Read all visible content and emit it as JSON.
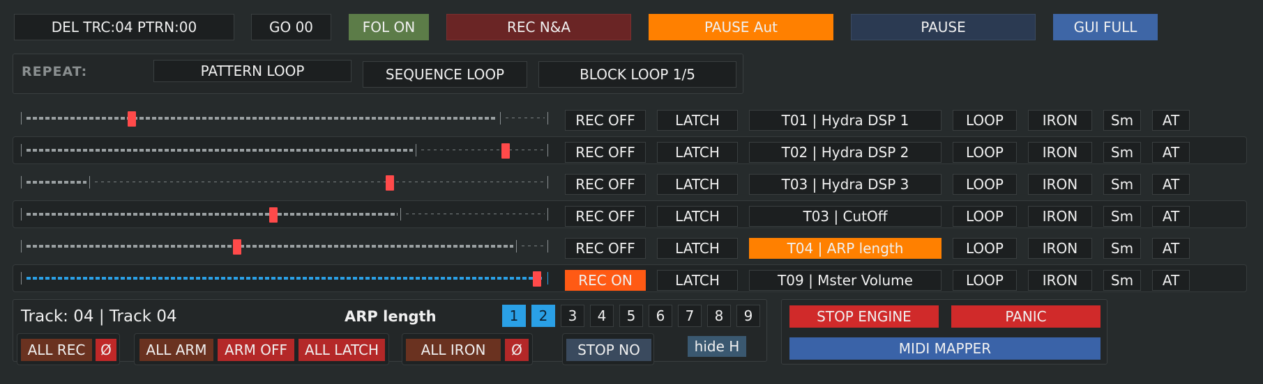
{
  "top": {
    "del_label": "DEL TRC:04 PTRN:00",
    "go_label": "GO 00",
    "fol_label": "FOL ON",
    "rec_na_label": "REC N&A",
    "pause_aut_label": "PAUSE Aut",
    "pause_label": "PAUSE",
    "gui_full_label": "GUI FULL"
  },
  "repeat": {
    "label": "REPEAT:",
    "pattern_loop": "PATTERN LOOP",
    "sequence_loop": "SEQUENCE LOOP",
    "block_loop": "BLOCK LOOP 1/5"
  },
  "tracks": [
    {
      "rec": "REC OFF",
      "latch": "LATCH",
      "name": "T01 | Hydra DSP 1",
      "loop": "LOOP",
      "iron": "IRON",
      "sm": "Sm",
      "at": "AT",
      "value": 0.21,
      "range_end": 0.91
    },
    {
      "rec": "REC OFF",
      "latch": "LATCH",
      "name": "T02 | Hydra  DSP 2",
      "loop": "LOOP",
      "iron": "IRON",
      "sm": "Sm",
      "at": "AT",
      "value": 0.92,
      "range_end": 0.75
    },
    {
      "rec": "REC OFF",
      "latch": "LATCH",
      "name": "T03 | Hydra DSP 3",
      "loop": "LOOP",
      "iron": "IRON",
      "sm": "Sm",
      "at": "AT",
      "value": 0.7,
      "range_end": 0.13
    },
    {
      "rec": "REC OFF",
      "latch": "LATCH",
      "name": "T03 | CutOff",
      "loop": "LOOP",
      "iron": "IRON",
      "sm": "Sm",
      "at": "AT",
      "value": 0.48,
      "range_end": 0.72
    },
    {
      "rec": "REC OFF",
      "latch": "LATCH",
      "name": "T04 | ARP length",
      "loop": "LOOP",
      "iron": "IRON",
      "sm": "Sm",
      "at": "AT",
      "value": 0.41,
      "range_end": 0.94
    },
    {
      "rec": "REC ON",
      "latch": "LATCH",
      "name": "T09 | Mster Volume",
      "loop": "LOOP",
      "iron": "IRON",
      "sm": "Sm",
      "at": "AT",
      "value": 0.98,
      "range_end": 1.0
    }
  ],
  "bottom": {
    "track_info": "Track: 04 | Track 04",
    "param_name": "ARP length",
    "numbers": [
      "1",
      "2",
      "3",
      "4",
      "5",
      "6",
      "7",
      "8",
      "9"
    ],
    "all_rec": "ALL REC",
    "null1": "Ø",
    "all_arm": "ALL ARM",
    "arm_off": "ARM OFF",
    "all_latch": "ALL LATCH",
    "all_iron": "ALL IRON",
    "null2": "Ø",
    "stop_no": "STOP NO",
    "hide_h": "hide H",
    "stop_engine": "STOP ENGINE",
    "panic": "PANIC",
    "midi_mapper": "MIDI MAPPER"
  },
  "colors": {
    "accent_orange": "#ff8000",
    "green": "#5c7c48",
    "dark_red": "#6a2525",
    "navy": "#2b3a52",
    "blue": "#3e66a6",
    "knob_red": "#ff4a4a",
    "selected_blue": "#2aa0e6",
    "brown": "#6a3220",
    "red": "#d02a2a",
    "midi_blue": "#3a63a8"
  }
}
